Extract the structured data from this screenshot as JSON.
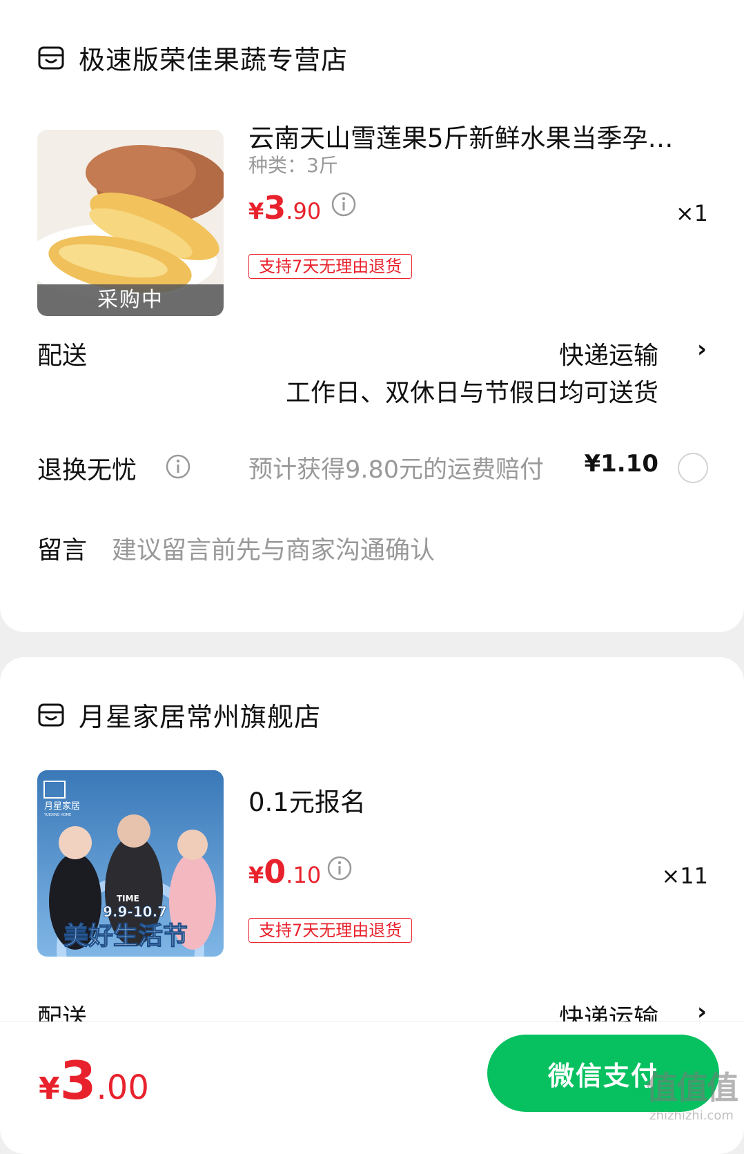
{
  "order": [
    {
      "shop_name": "极速版荣佳果蔬专营店",
      "product": {
        "title": "云南天山雪莲果5斤新鲜水果当季孕…",
        "spec": "种类：3斤",
        "price_currency": "¥",
        "price_int": "3",
        "price_dec": ".90",
        "quantity": "×1",
        "tag": "支持7天无理由退货",
        "image_label": "采购中"
      },
      "delivery": {
        "label": "配送",
        "method": "快递运输",
        "note": "工作日、双休日与节假日均可送货"
      },
      "return_insurance": {
        "label": "退换无忧",
        "desc": "预计获得9.80元的运费赔付",
        "price": "¥1.10"
      },
      "message": {
        "label": "留言",
        "placeholder": "建议留言前先与商家沟通确认"
      }
    },
    {
      "shop_name": "月星家居常州旗舰店",
      "product": {
        "title": "0.1元报名",
        "price_currency": "¥",
        "price_int": "0",
        "price_dec": ".10",
        "quantity": "×11",
        "tag": "支持7天无理由退货",
        "image_texts": [
          "月星家居",
          "YUEXING HOME",
          "TIME",
          "9.9-10.7",
          "美好生活节"
        ]
      },
      "delivery": {
        "label": "配送",
        "method": "快递运输"
      }
    }
  ],
  "footer": {
    "total_currency": "¥",
    "total_int": "3",
    "total_dec": ".00",
    "pay_button": "微信支付"
  },
  "watermark": {
    "big": "值值值",
    "small": "zhizhizhi.com"
  },
  "colors": {
    "accent_red": "#e8222c",
    "wechat_green": "#07c160"
  }
}
